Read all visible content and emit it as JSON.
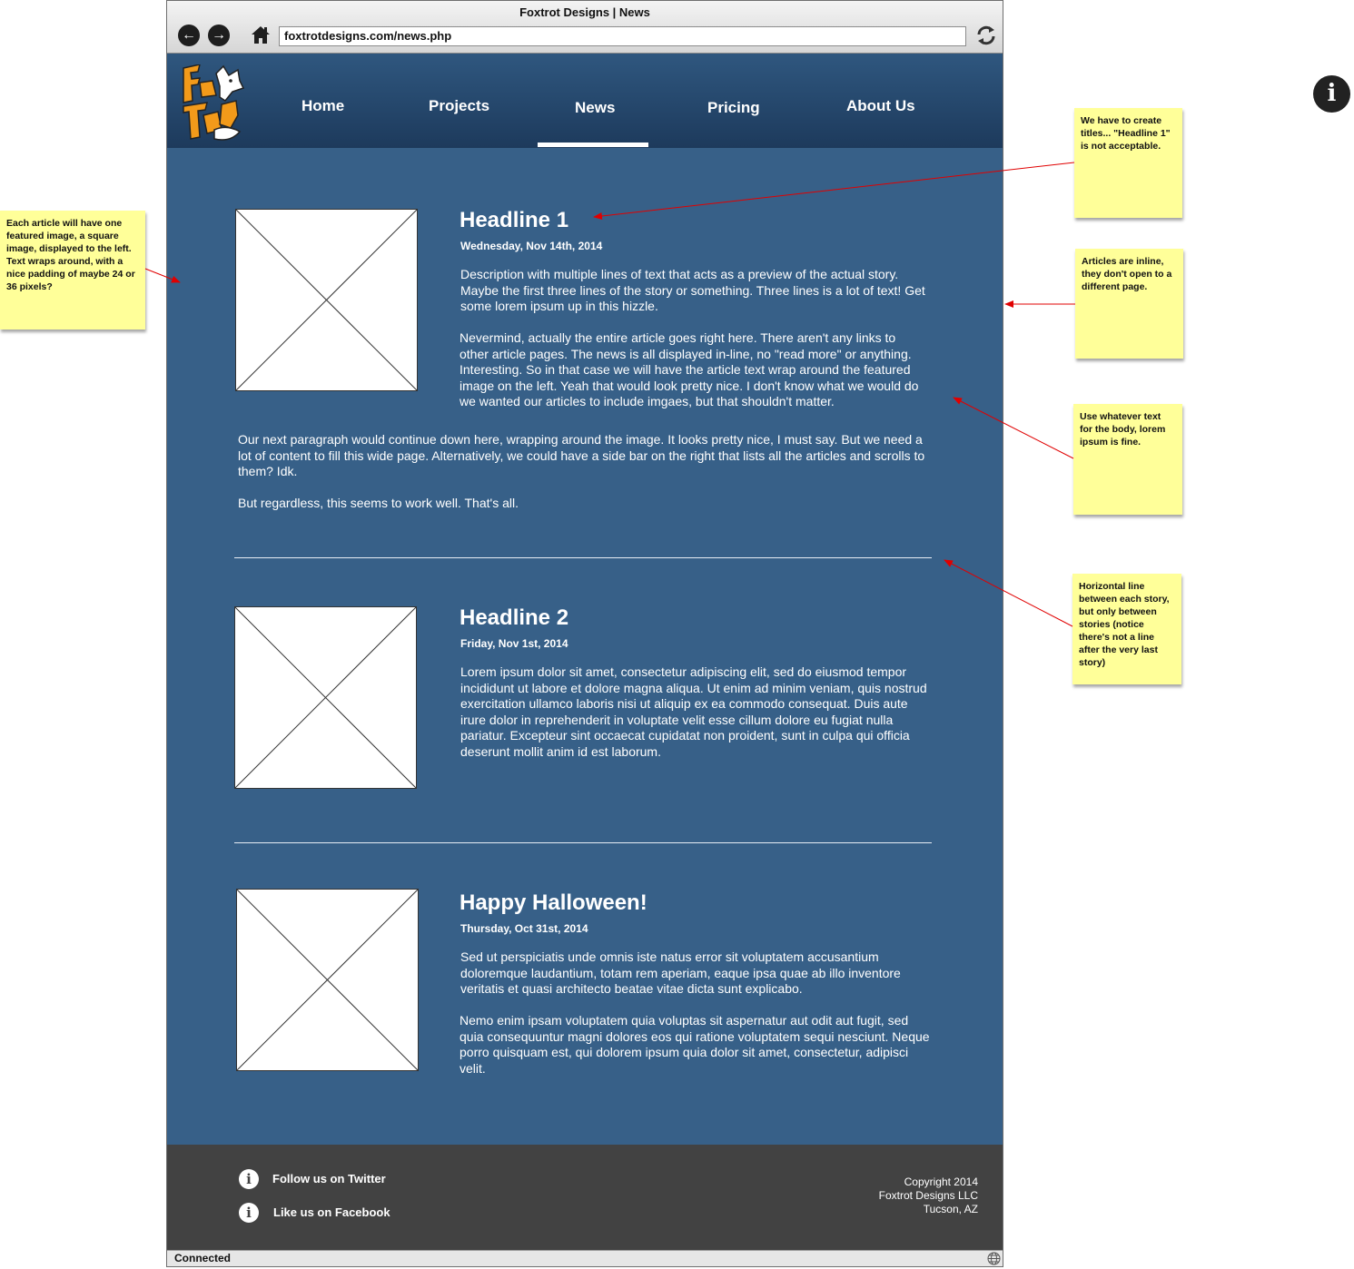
{
  "window": {
    "title": "Foxtrot Designs | News",
    "url": "foxtrotdesigns.com/news.php"
  },
  "nav": {
    "home": "Home",
    "projects": "Projects",
    "news": "News",
    "pricing": "Pricing",
    "about": "About Us"
  },
  "articles": [
    {
      "headline": "Headline 1",
      "date": "Wednesday, Nov 14th, 2014",
      "p1": [
        "Description with multiple lines of text that acts as a preview of the actual story.",
        "Maybe the first three lines of the story or something. Three lines is a lot of text! Get",
        "some lorem ipsum up in this hizzle."
      ],
      "p2": [
        "Nevermind, actually the entire article goes right here. There aren't any links to",
        "other article pages. The news is all displayed in-line, no \"read more\" or anything.",
        "Interesting. So in that case we will have the article text wrap around the featured",
        "image on the left. Yeah that would look pretty nice. I don't know what we would do",
        "we wanted our articles to include imgaes, but that shouldn't matter."
      ],
      "p3": [
        "Our next paragraph would continue down here, wrapping around the image. It looks pretty nice, I must say. But we need a",
        "lot of content to fill this wide page. Alternatively, we could have a side bar on the right that lists all the articles and scrolls to",
        "them? Idk."
      ],
      "p4": [
        "But regardless, this seems to work well. That's all."
      ]
    },
    {
      "headline": "Headline 2",
      "date": "Friday, Nov 1st, 2014",
      "p1": [
        "Lorem ipsum dolor sit amet, consectetur adipiscing elit, sed do eiusmod tempor",
        "incididunt ut labore et dolore magna aliqua. Ut enim ad minim veniam, quis nostrud",
        "exercitation ullamco laboris nisi ut aliquip ex ea commodo consequat. Duis aute",
        "irure dolor in reprehenderit in voluptate velit esse cillum dolore eu fugiat nulla",
        "pariatur. Excepteur sint occaecat cupidatat non proident, sunt in culpa qui officia",
        "deserunt mollit anim id est laborum."
      ]
    },
    {
      "headline": "Happy Halloween!",
      "date": "Thursday, Oct 31st, 2014",
      "p1": [
        "Sed ut perspiciatis unde omnis iste natus error sit voluptatem accusantium",
        "doloremque laudantium, totam rem aperiam, eaque ipsa quae ab illo inventore",
        "veritatis et quasi architecto beatae vitae dicta sunt explicabo."
      ],
      "p2": [
        "Nemo enim ipsam voluptatem quia voluptas sit aspernatur aut odit aut fugit, sed",
        "quia consequuntur magni dolores eos qui ratione voluptatem sequi nesciunt. Neque",
        "porro quisquam est, qui dolorem ipsum quia dolor sit amet, consectetur, adipisci",
        "velit."
      ]
    }
  ],
  "footer": {
    "twitter": "Follow us on Twitter",
    "facebook": "Like us on Facebook",
    "copyright": [
      "Copyright 2014",
      "Foxtrot Designs LLC",
      "Tucson, AZ"
    ]
  },
  "status": "Connected",
  "notes": {
    "left": "Each article will have one featured image, a square image, displayed to the left. Text wraps around, with a nice padding of maybe 24 or 36 pixels?",
    "titles": "We have to create titles... \"Headline 1\" is not acceptable.",
    "inline": "Articles are inline, they don't open to a different page.",
    "body": "Use whatever text for the body, lorem ipsum is fine.",
    "hline": "Horizontal line between each story, but only between stories (notice there's not a line after the very last story)"
  },
  "colors": {
    "page_bg": "#376088",
    "header_bg": "#1d3a5c",
    "footer_bg": "#424242",
    "note_bg": "#ffff99",
    "arrow": "#e00000"
  }
}
